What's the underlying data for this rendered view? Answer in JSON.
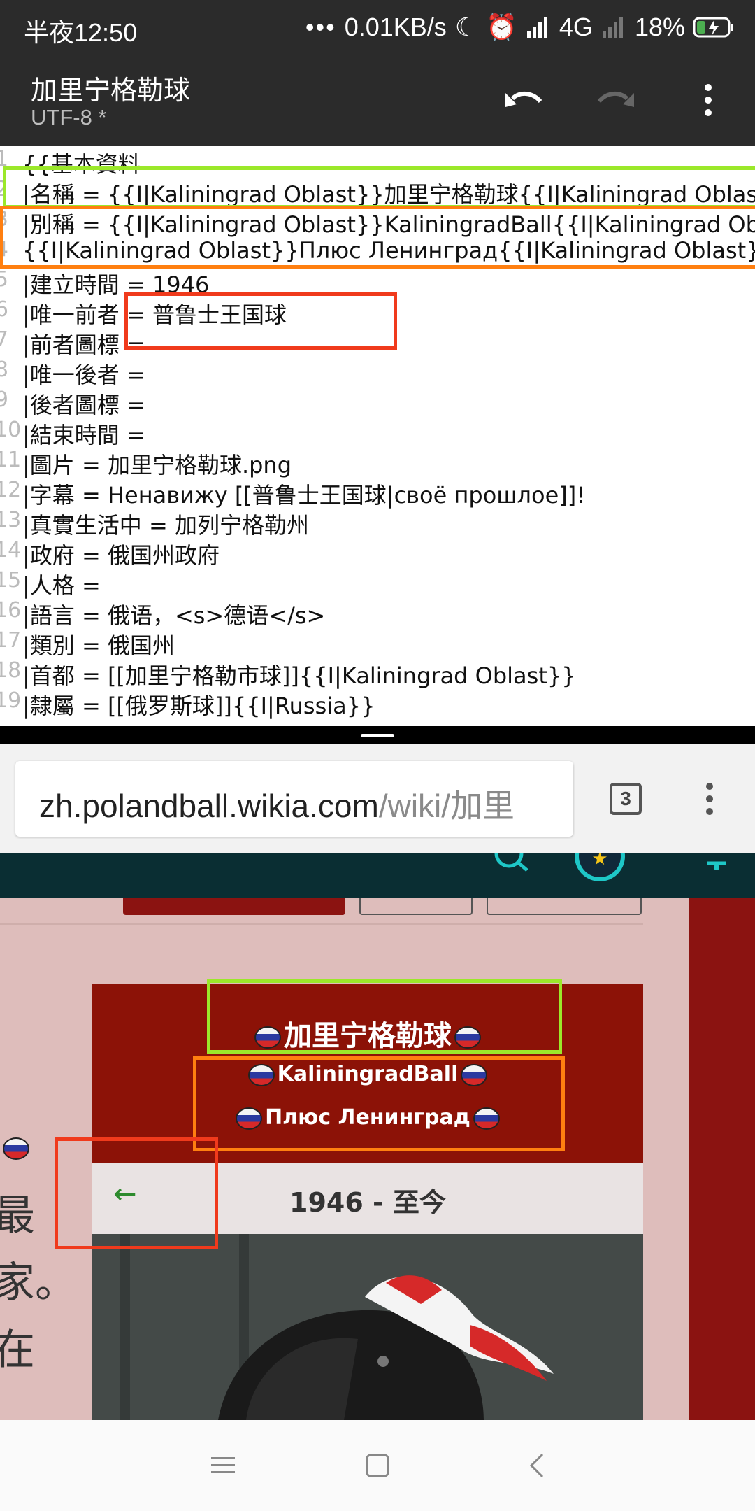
{
  "status_bar": {
    "time": "半夜12:50",
    "net_speed": "0.01KB/s",
    "network": "4G",
    "battery": "18%"
  },
  "editor_app": {
    "title": "加里宁格勒球",
    "encoding": "UTF-8 *",
    "icons": [
      "undo-icon",
      "redo-icon",
      "more-vert-icon"
    ]
  },
  "editor": {
    "lines": [
      {
        "num": "1",
        "text": "{{基本資料"
      },
      {
        "num": "2",
        "text": "|名稱 = {{I|Kaliningrad Oblast}}加里宁格勒球{{I|Kaliningrad Oblast}}"
      },
      {
        "num": "3",
        "text": "|別稱 = {{I|Kaliningrad Oblast}}KaliningradBall{{I|Kaliningrad Oblast}}"
      },
      {
        "num": "4",
        "text": "{{I|Kaliningrad Oblast}}Плюс Ленинград{{I|Kaliningrad Oblast}}"
      },
      {
        "num": "5",
        "text": "|建立時間 = 1946"
      },
      {
        "num": "6",
        "text": "|唯一前者 = 普鲁士王国球"
      },
      {
        "num": "7",
        "text": "|前者圖標 ="
      },
      {
        "num": "8",
        "text": "|唯一後者 ="
      },
      {
        "num": "9",
        "text": "|後者圖標 ="
      },
      {
        "num": "10",
        "text": "|結束時間 ="
      },
      {
        "num": "11",
        "text": "|圖片 = 加里宁格勒球.png"
      },
      {
        "num": "12",
        "text": "|字幕 = Ненавижу [[普鲁士王国球|своё прошлое]]!"
      },
      {
        "num": "13",
        "text": "|真實生活中 = 加列宁格勒州"
      },
      {
        "num": "14",
        "text": "|政府 = 俄国州政府"
      },
      {
        "num": "15",
        "text": "|人格 ="
      },
      {
        "num": "16",
        "text": "|語言 = 俄语，<s>德语</s>"
      },
      {
        "num": "17",
        "text": "|類別 = 俄国州"
      },
      {
        "num": "18",
        "text": "|首都 = [[加里宁格勒市球]]{{I|Kaliningrad Oblast}}"
      },
      {
        "num": "19",
        "text": "|隸屬 = [[俄罗斯球]]{{I|Russia}}"
      }
    ]
  },
  "highlight_colors": {
    "green": "#9be82a",
    "orange": "#ff7f10",
    "red": "#f03a1c"
  },
  "browser": {
    "url_host": "zh.polandball.wikia.com",
    "url_path": "/wiki/加里",
    "tab_count": "3",
    "icons": [
      "tab-switcher-icon",
      "more-vert-icon"
    ]
  },
  "wiki_page": {
    "infobox_title": "加里宁格勒球",
    "alias_1": "KaliningradBall",
    "alias_2": "Плюс Ленинград",
    "prev_arrow": "←",
    "period": "1946 - 至今",
    "left_edge_text": [
      "最",
      "家。",
      "在"
    ]
  },
  "nav_bar": {
    "icons": [
      "menu-icon",
      "home-icon",
      "back-icon"
    ]
  }
}
